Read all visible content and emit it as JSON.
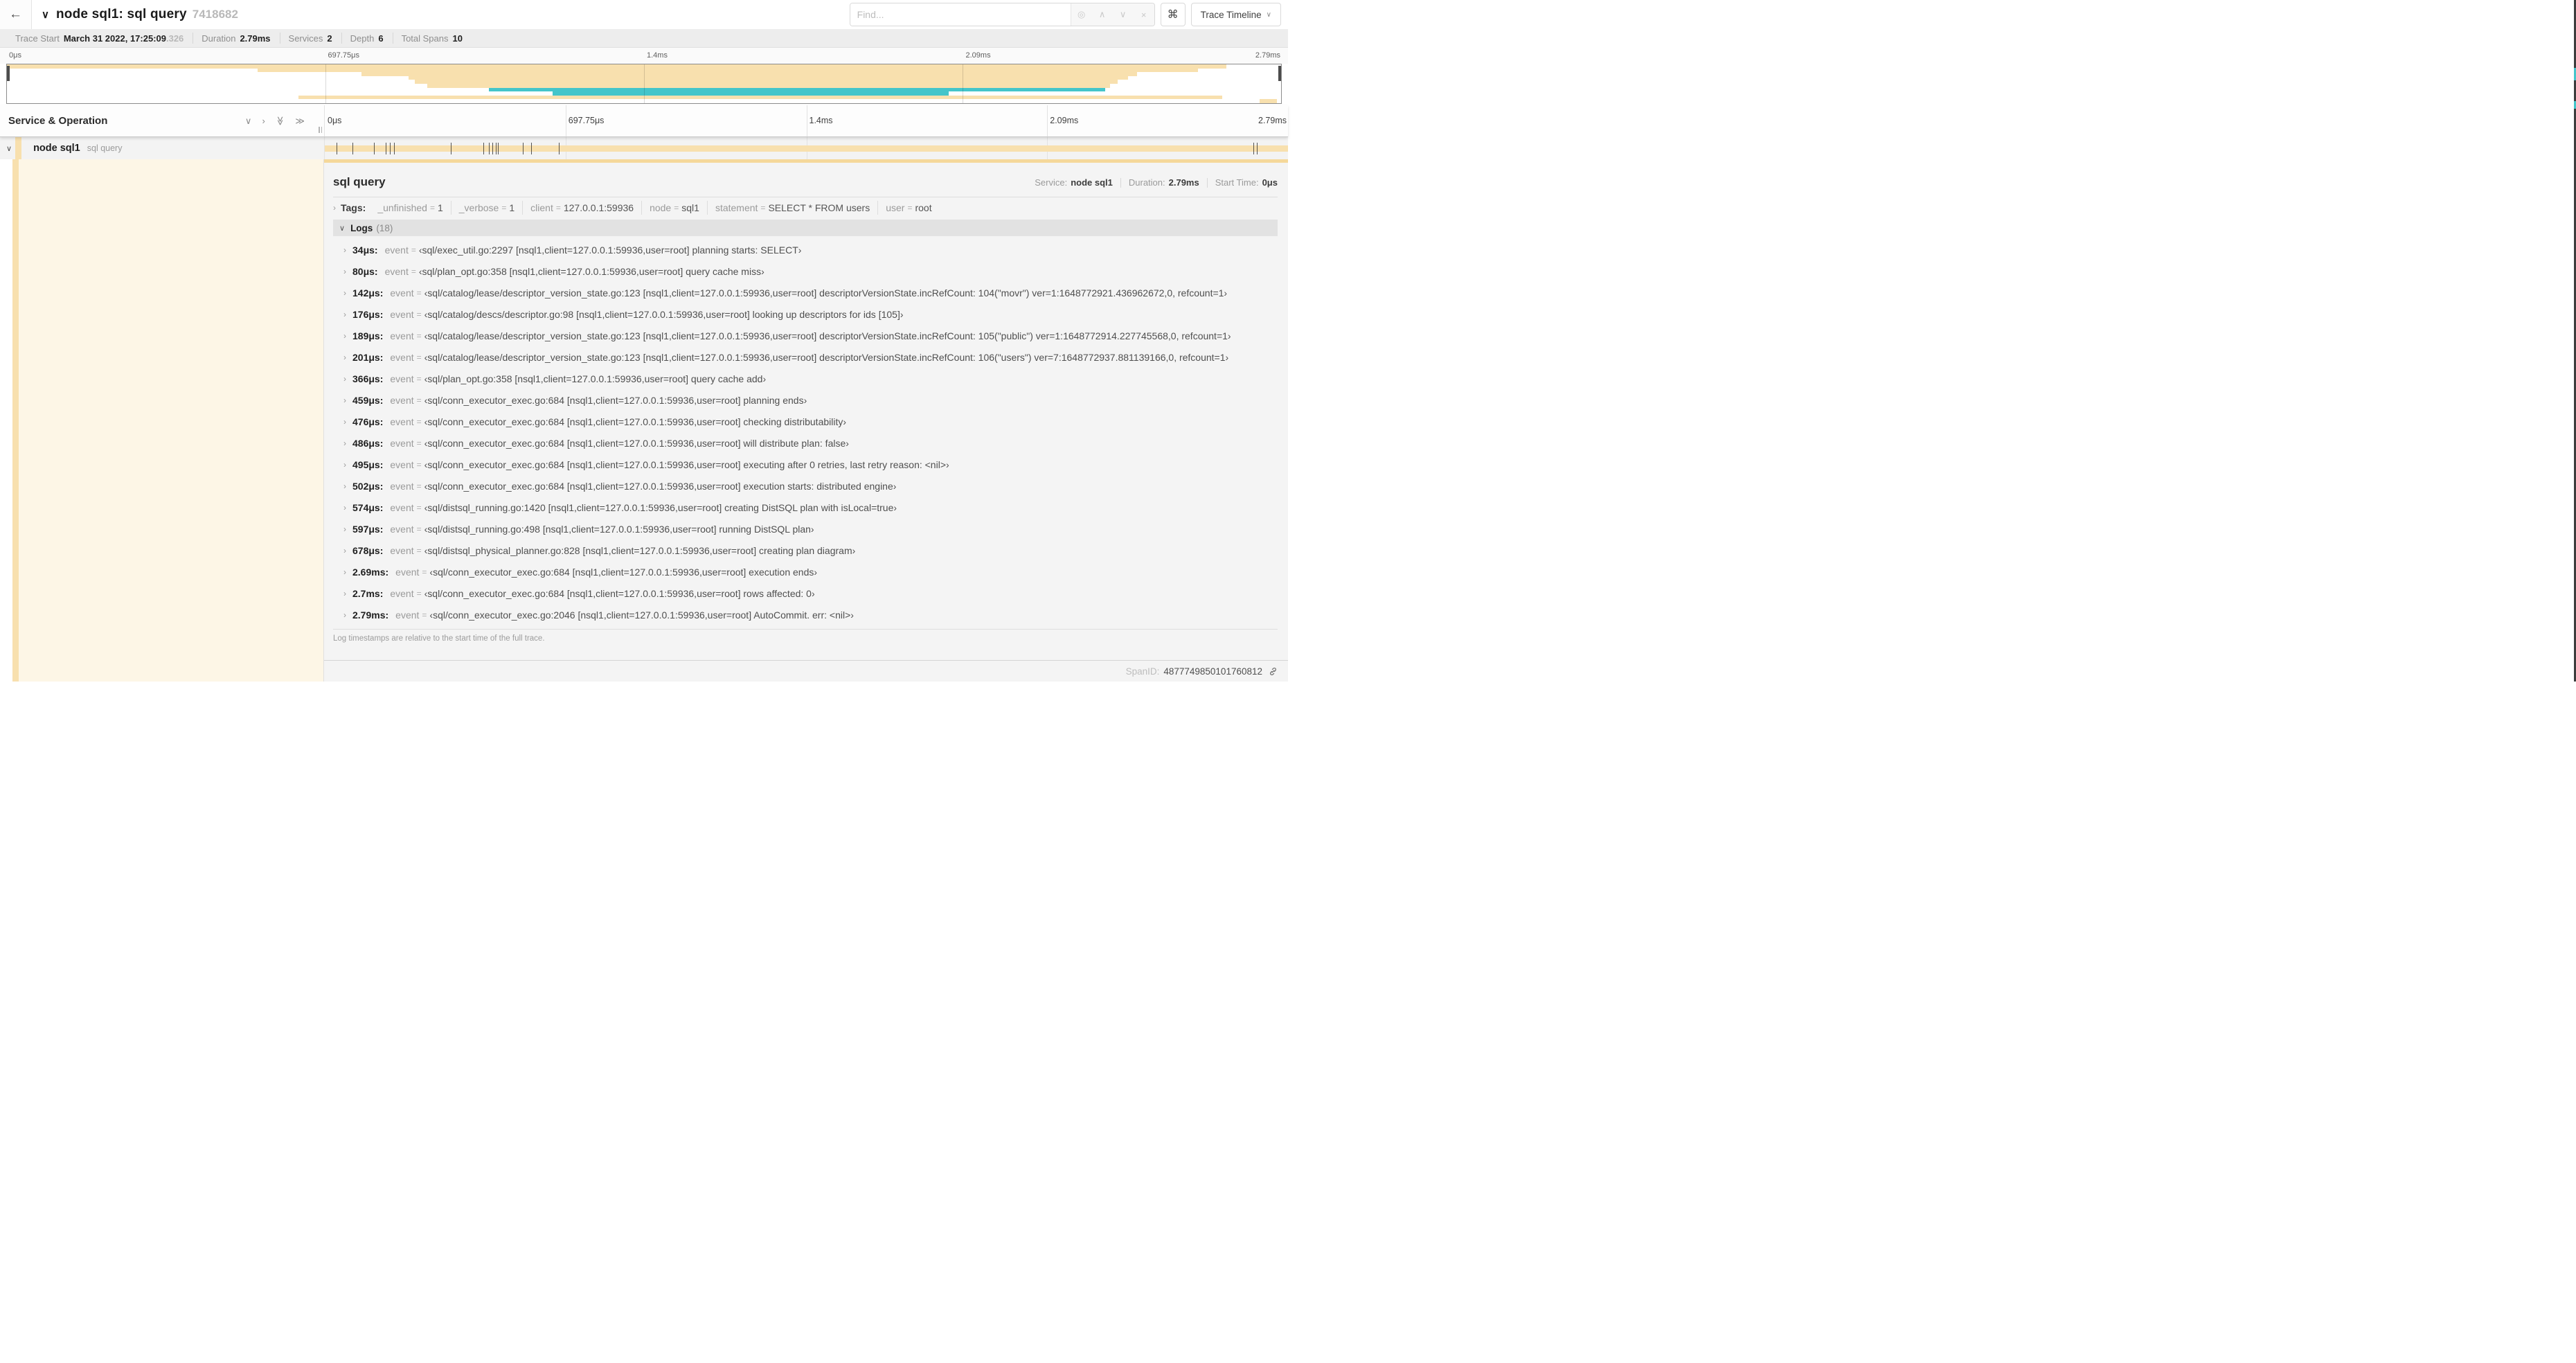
{
  "icons": {
    "back": "←",
    "collapse_header": "∨",
    "find_target": "◎",
    "find_prev": "∧",
    "find_next": "∨",
    "find_clear": "×",
    "keyboard": "⌘",
    "dropdown_caret": "∨",
    "collapse_one": "∨",
    "expand_one": "›",
    "collapse_all": "≫",
    "expand_all": "≫",
    "row_chevron": "∨",
    "tags_chevron": "›",
    "logs_chevron": "∨",
    "log_chevron": "›"
  },
  "header": {
    "title": "node sql1: sql query",
    "trace_id": "7418682",
    "find_placeholder": "Find...",
    "view_button": "Trace Timeline"
  },
  "summary": {
    "items": [
      {
        "label": "Trace Start",
        "value": "March 31 2022, 17:25:09",
        "suffix": ".326"
      },
      {
        "label": "Duration",
        "value": "2.79ms",
        "suffix": ""
      },
      {
        "label": "Services",
        "value": "2",
        "suffix": ""
      },
      {
        "label": "Depth",
        "value": "6",
        "suffix": ""
      },
      {
        "label": "Total Spans",
        "value": "10",
        "suffix": ""
      }
    ]
  },
  "colors": {
    "tan": "#f8e0ae",
    "teal": "#45c5ca",
    "row_highlight": "#fdf6e6",
    "accent_bar": "#f5d89a"
  },
  "minimap": {
    "ticks": [
      "0μs",
      "697.75μs",
      "1.4ms",
      "2.09ms",
      "2.79ms"
    ],
    "rows": [
      {
        "segments": [
          {
            "start": 0.0,
            "end": 0.957,
            "color": "tan"
          }
        ]
      },
      {
        "segments": [
          {
            "start": 0.197,
            "end": 0.935,
            "color": "tan"
          }
        ]
      },
      {
        "segments": [
          {
            "start": 0.278,
            "end": 0.887,
            "color": "tan"
          }
        ]
      },
      {
        "segments": [
          {
            "start": 0.315,
            "end": 0.88,
            "color": "tan"
          }
        ]
      },
      {
        "segments": [
          {
            "start": 0.32,
            "end": 0.872,
            "color": "tan"
          }
        ]
      },
      {
        "segments": [
          {
            "start": 0.33,
            "end": 0.866,
            "color": "tan"
          }
        ]
      },
      {
        "segments": [
          {
            "start": 0.378,
            "end": 0.862,
            "color": "teal"
          }
        ]
      },
      {
        "segments": [
          {
            "start": 0.428,
            "end": 0.739,
            "color": "teal"
          }
        ]
      },
      {
        "segments": [
          {
            "start": 0.229,
            "end": 0.954,
            "color": "tan"
          }
        ]
      },
      {
        "segments": [
          {
            "start": 0.983,
            "end": 0.997,
            "color": "tan"
          }
        ]
      }
    ]
  },
  "timeline": {
    "column_header": "Service & Operation",
    "ticks": [
      "0μs",
      "697.75μs",
      "1.4ms",
      "2.09ms",
      "2.79ms"
    ],
    "row": {
      "service": "node sql1",
      "operation": "sql query"
    },
    "duration_us": 2790,
    "log_marker_times_us": [
      34,
      80,
      142,
      176,
      189,
      201,
      366,
      459,
      476,
      486,
      495,
      502,
      574,
      597,
      678,
      2690,
      2700,
      2789
    ]
  },
  "detail": {
    "title": "sql query",
    "meta": [
      {
        "label": "Service:",
        "value": "node sql1"
      },
      {
        "label": "Duration:",
        "value": "2.79ms"
      },
      {
        "label": "Start Time:",
        "value": "0μs"
      }
    ],
    "tags_label": "Tags:",
    "tags": [
      {
        "key": "_unfinished",
        "value": "1"
      },
      {
        "key": "_verbose",
        "value": "1"
      },
      {
        "key": "client",
        "value": "127.0.0.1:59936"
      },
      {
        "key": "node",
        "value": "sql1"
      },
      {
        "key": "statement",
        "value": "SELECT * FROM users"
      },
      {
        "key": "user",
        "value": "root"
      }
    ],
    "logs_title": "Logs",
    "logs_count": "(18)",
    "log_key": "event",
    "logs": [
      {
        "time": "34μs:",
        "value": "‹sql/exec_util.go:2297 [nsql1,client=127.0.0.1:59936,user=root] planning starts: SELECT›"
      },
      {
        "time": "80μs:",
        "value": "‹sql/plan_opt.go:358 [nsql1,client=127.0.0.1:59936,user=root] query cache miss›"
      },
      {
        "time": "142μs:",
        "value": "‹sql/catalog/lease/descriptor_version_state.go:123 [nsql1,client=127.0.0.1:59936,user=root] descriptorVersionState.incRefCount: 104(\"movr\") ver=1:1648772921.436962672,0, refcount=1›"
      },
      {
        "time": "176μs:",
        "value": "‹sql/catalog/descs/descriptor.go:98 [nsql1,client=127.0.0.1:59936,user=root] looking up descriptors for ids [105]›"
      },
      {
        "time": "189μs:",
        "value": "‹sql/catalog/lease/descriptor_version_state.go:123 [nsql1,client=127.0.0.1:59936,user=root] descriptorVersionState.incRefCount: 105(\"public\") ver=1:1648772914.227745568,0, refcount=1›"
      },
      {
        "time": "201μs:",
        "value": "‹sql/catalog/lease/descriptor_version_state.go:123 [nsql1,client=127.0.0.1:59936,user=root] descriptorVersionState.incRefCount: 106(\"users\") ver=7:1648772937.881139166,0, refcount=1›"
      },
      {
        "time": "366μs:",
        "value": "‹sql/plan_opt.go:358 [nsql1,client=127.0.0.1:59936,user=root] query cache add›"
      },
      {
        "time": "459μs:",
        "value": "‹sql/conn_executor_exec.go:684 [nsql1,client=127.0.0.1:59936,user=root] planning ends›"
      },
      {
        "time": "476μs:",
        "value": "‹sql/conn_executor_exec.go:684 [nsql1,client=127.0.0.1:59936,user=root] checking distributability›"
      },
      {
        "time": "486μs:",
        "value": "‹sql/conn_executor_exec.go:684 [nsql1,client=127.0.0.1:59936,user=root] will distribute plan: false›"
      },
      {
        "time": "495μs:",
        "value": "‹sql/conn_executor_exec.go:684 [nsql1,client=127.0.0.1:59936,user=root] executing after 0 retries, last retry reason: <nil>›"
      },
      {
        "time": "502μs:",
        "value": "‹sql/conn_executor_exec.go:684 [nsql1,client=127.0.0.1:59936,user=root] execution starts: distributed engine›"
      },
      {
        "time": "574μs:",
        "value": "‹sql/distsql_running.go:1420 [nsql1,client=127.0.0.1:59936,user=root] creating DistSQL plan with isLocal=true›"
      },
      {
        "time": "597μs:",
        "value": "‹sql/distsql_running.go:498 [nsql1,client=127.0.0.1:59936,user=root] running DistSQL plan›"
      },
      {
        "time": "678μs:",
        "value": "‹sql/distsql_physical_planner.go:828 [nsql1,client=127.0.0.1:59936,user=root] creating plan diagram›"
      },
      {
        "time": "2.69ms:",
        "value": "‹sql/conn_executor_exec.go:684 [nsql1,client=127.0.0.1:59936,user=root] execution ends›"
      },
      {
        "time": "2.7ms:",
        "value": "‹sql/conn_executor_exec.go:684 [nsql1,client=127.0.0.1:59936,user=root] rows affected: 0›"
      },
      {
        "time": "2.79ms:",
        "value": "‹sql/conn_executor_exec.go:2046 [nsql1,client=127.0.0.1:59936,user=root] AutoCommit. err: <nil>›"
      }
    ],
    "footer_note": "Log timestamps are relative to the start time of the full trace.",
    "span_id_label": "SpanID:",
    "span_id": "4877749850101760812"
  }
}
